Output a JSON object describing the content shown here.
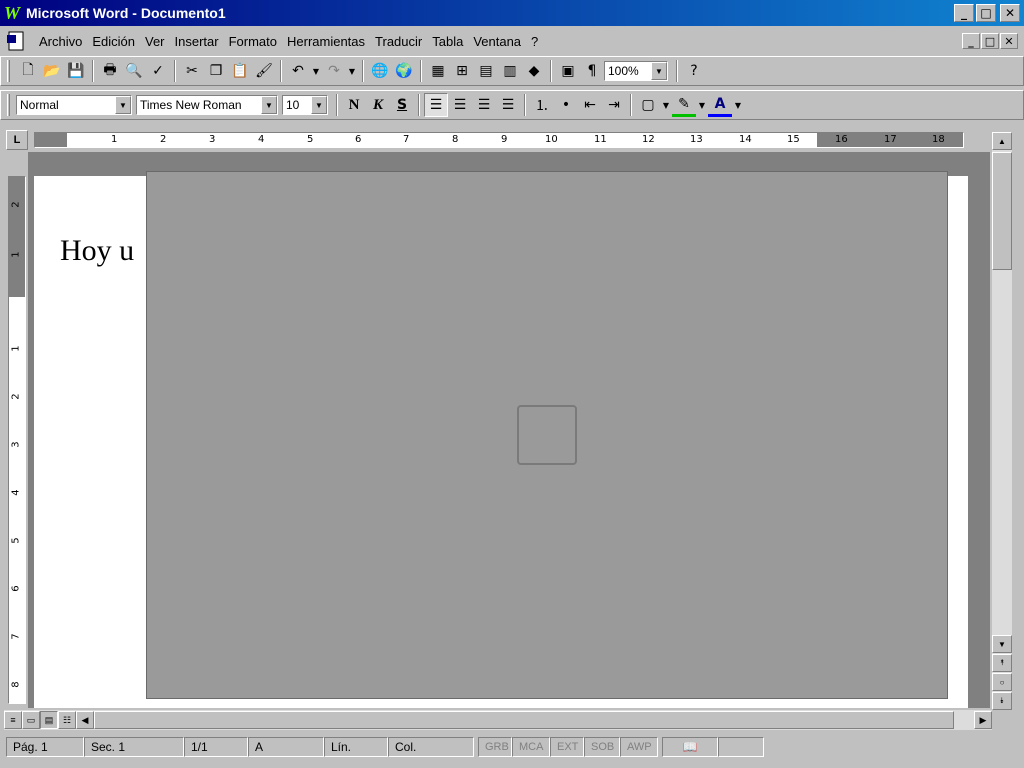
{
  "window": {
    "title": "Microsoft Word - Documento1",
    "app_icon": "W",
    "buttons": {
      "minimize": "_",
      "maximize": "□",
      "close": "✕"
    }
  },
  "menubar": {
    "items": [
      "Archivo",
      "Edición",
      "Ver",
      "Insertar",
      "Formato",
      "Herramientas",
      "Traducir",
      "Tabla",
      "Ventana",
      "?"
    ]
  },
  "toolbar_standard": {
    "zoom": "100%"
  },
  "toolbar_format": {
    "style": "Normal",
    "font": "Times New Roman",
    "size": "10",
    "bold_label": "N",
    "italic_label": "K",
    "underline_label": "S"
  },
  "ruler": {
    "horizontal_ticks": [
      "1",
      "2",
      "3",
      "4",
      "5",
      "6",
      "7",
      "8",
      "9",
      "10",
      "11",
      "12",
      "13",
      "14",
      "15",
      "16",
      "17",
      "18"
    ],
    "vertical_ticks": [
      "2",
      "1",
      "1",
      "2",
      "3",
      "4",
      "5",
      "6",
      "7",
      "8"
    ],
    "corner_label": "L"
  },
  "document": {
    "text": "Hoy u",
    "image": "embedded photo not reproduced"
  },
  "statusbar": {
    "page": "Pág. 1",
    "section": "Sec. 1",
    "pages": "1/1",
    "at": "A",
    "line": "Lín.",
    "column": "Col.",
    "flags": [
      "GRB",
      "MCA",
      "EXT",
      "SOB",
      "AWP"
    ]
  },
  "colors": {
    "title_bar_start": "#000080",
    "title_bar_end": "#1084d0",
    "chrome": "#c0c0c0"
  }
}
